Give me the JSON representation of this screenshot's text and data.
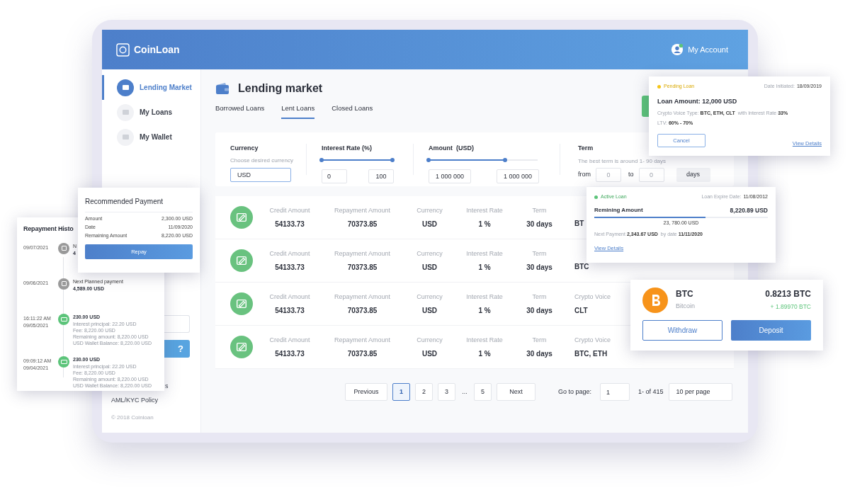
{
  "header": {
    "logo": "CoinLoan",
    "account": "My Account"
  },
  "sidebar": {
    "items": [
      {
        "label": "Lending Market",
        "selected": true
      },
      {
        "label": "My Loans",
        "selected": false
      },
      {
        "label": "My Wallet",
        "selected": false
      }
    ],
    "promo_button": "?",
    "links": [
      "s",
      "AML/KYC Policy"
    ],
    "copyright": "© 2018 Coinloan"
  },
  "page": {
    "title": "Lending market"
  },
  "tabs": [
    {
      "label": "Borrowed Loans",
      "selected": false
    },
    {
      "label": "Lent Loans",
      "selected": true
    },
    {
      "label": "Closed Loans",
      "selected": false
    }
  ],
  "filters": {
    "currency": {
      "label": "Currency",
      "hint": "Choose desired currency",
      "value": "USD"
    },
    "interest": {
      "label": "Interest Rate (%)",
      "level": 1,
      "min": "0",
      "max": "100"
    },
    "amount": {
      "label": "Amount  (USD)",
      "level": 0.7,
      "min": "1 000 000",
      "max": "1 000 000"
    },
    "term": {
      "label": "Term",
      "hint": "The best term is around 1- 90 days",
      "from_label": "from",
      "from_placeholder": "0",
      "to_label": "to",
      "to_placeholder": "0",
      "unit": "days"
    }
  },
  "loans": [
    {
      "cells": [
        {
          "label": "Credit Amount",
          "value": "54133.73"
        },
        {
          "label": "Repayment Amount",
          "value": "70373.85"
        },
        {
          "label": "Currency",
          "value": "USD"
        },
        {
          "label": "Interest Rate",
          "value": "1 %"
        },
        {
          "label": "Term",
          "value": "30 days"
        },
        {
          "value": "BT"
        }
      ]
    },
    {
      "cells": [
        {
          "label": "Credit Amount",
          "value": "54133.73"
        },
        {
          "label": "Repayment Amount",
          "value": "70373.85"
        },
        {
          "label": "Currency",
          "value": "USD"
        },
        {
          "label": "Interest Rate",
          "value": "1 %"
        },
        {
          "label": "Term",
          "value": "30 days"
        },
        {
          "value": "BTC"
        }
      ]
    },
    {
      "cells": [
        {
          "label": "Credit Amount",
          "value": "54133.73"
        },
        {
          "label": "Repayment Amount",
          "value": "70373.85"
        },
        {
          "label": "Currency",
          "value": "USD"
        },
        {
          "label": "Interest Rate",
          "value": "1 %"
        },
        {
          "label": "Term",
          "value": "30 days"
        },
        {
          "label": "Crypto Voice",
          "value": "CLT"
        }
      ]
    },
    {
      "cells": [
        {
          "label": "Credit Amount",
          "value": "54133.73"
        },
        {
          "label": "Repayment Amount",
          "value": "70373.85"
        },
        {
          "label": "Currency",
          "value": "USD"
        },
        {
          "label": "Interest Rate",
          "value": "1 %"
        },
        {
          "label": "Term",
          "value": "30 days"
        },
        {
          "label": "Crypto Voice",
          "value": "BTC, ETH"
        }
      ]
    }
  ],
  "pagination": {
    "previous": "Previous",
    "pages": [
      {
        "label": "1",
        "selected": true
      },
      {
        "label": "2",
        "selected": false
      },
      {
        "label": "3",
        "selected": false
      },
      {
        "label": "...",
        "kind": "gap"
      },
      {
        "label": "5",
        "selected": false
      }
    ],
    "next": "Next",
    "goto_label": "Go to page:",
    "goto_value": "1",
    "range": "1- of 415",
    "per_page": "10 per page"
  },
  "repayment_history": {
    "title": "Repayment Histo",
    "entries": [
      {
        "kind": "planned",
        "time": "09/07/2021",
        "title": "N",
        "amount": "4"
      },
      {
        "kind": "planned",
        "time": "09/06/2021",
        "title": "Next Planned payment",
        "amount": "4,589.00 USD"
      },
      {
        "kind": "paid",
        "clock": "16:11:22 AM",
        "time": "09/05/2021",
        "amount": "230.00 USD",
        "details": [
          "Interest principal: 22.20 USD",
          "Fee: 8,220.00 USD",
          "Remaining amount: 8,220.00 USD",
          "USD Wallet Balance: 8,220.00 USD"
        ]
      },
      {
        "kind": "paid",
        "clock": "09:09:12 AM",
        "time": "09/04/2021",
        "amount": "230.00 USD",
        "details": [
          "Interest principal: 22.20 USD",
          "Fee: 8,220.00 USD",
          "Remaining amount: 8,220.00 USD",
          "USD Wallet Balance: 8,220.00 USD"
        ]
      }
    ]
  },
  "recommended_payment": {
    "title": "Recommended Payment",
    "rows": [
      {
        "label": "Amount",
        "value": "2,300.00 USD"
      },
      {
        "label": "Date",
        "value": "11/09/2020"
      },
      {
        "label": "Remaining Amount",
        "value": "8,220.00 USD"
      }
    ],
    "button": "Repay"
  },
  "pending_loan": {
    "status": {
      "label": "Pending Loan",
      "color": "#f5c518"
    },
    "date_label": "Date Initiated:",
    "date": "18/09/2019",
    "amount": "Loan Amount: 12,000 USD",
    "type_line": "Crypto Voice Type: **BTC, ETH, CLT**  with Interest Rate **33%**",
    "ltv_line": "LTV: **60% - 70%**",
    "cancel": "Cancel",
    "link": "View Details"
  },
  "active_loan": {
    "status": {
      "label": "Active Loan",
      "color": "#5cc47a"
    },
    "date_label": "Loan Expire Date:",
    "date": "11/08/2012",
    "remaining_label": "Remining Amount",
    "remaining": "8,220.89 USD",
    "level": 0.64,
    "total": "23, 780.00 USD",
    "payment_line": "Next Payment **2,343.67 USD**  by date **11/11/2020**",
    "link": "View Details"
  },
  "wallet": {
    "symbol": "BTC",
    "name": "Bitcoin",
    "balance": "0.8213 BTC",
    "change": "+ 1.89970 BTC",
    "withdraw": "Withdraw",
    "deposit": "Deposit"
  }
}
